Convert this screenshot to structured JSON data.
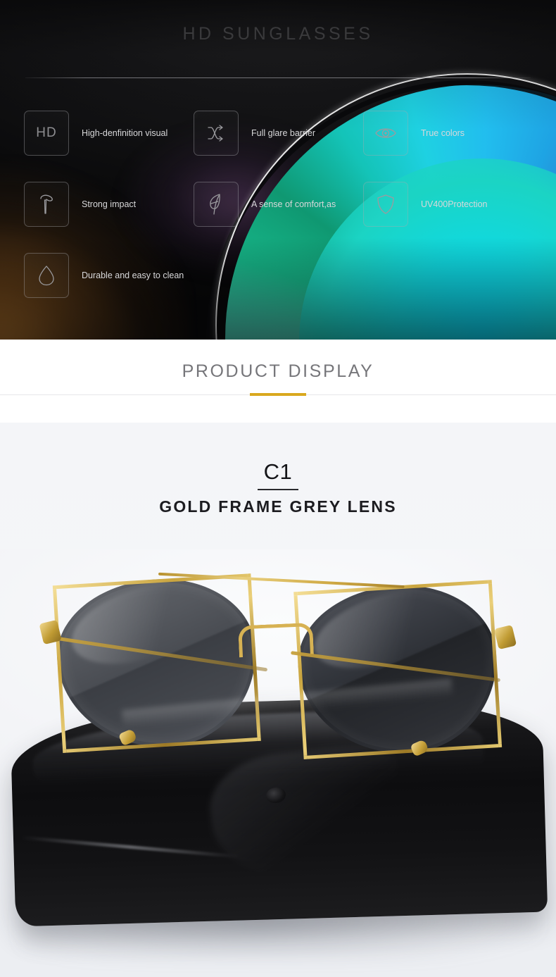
{
  "hero": {
    "title": "HD SUNGLASSES",
    "features": [
      {
        "icon": "hd-icon",
        "icon_text": "HD",
        "label": "High-denfinition visual"
      },
      {
        "icon": "shuffle-icon",
        "icon_text": "",
        "label": "Full glare barrier"
      },
      {
        "icon": "eye-icon",
        "icon_text": "",
        "label": "True colors"
      },
      {
        "icon": "hammer-icon",
        "icon_text": "",
        "label": "Strong impact"
      },
      {
        "icon": "feather-icon",
        "icon_text": "",
        "label": "A sense of comfort,as"
      },
      {
        "icon": "shield-icon",
        "icon_text": "",
        "label": "UV400Protection"
      },
      {
        "icon": "water-drop-icon",
        "icon_text": "",
        "label": "Durable and easy to clean"
      }
    ]
  },
  "section": {
    "title": "PRODUCT DISPLAY",
    "accent_color": "#d9a81e"
  },
  "product": {
    "code": "C1",
    "subtitle": "GOLD FRAME GREY LENS",
    "frame_color": "#d5ae4c",
    "lens_color": "#4a4d53",
    "case_color": "#131315",
    "background_color": "#f5f6f8"
  }
}
